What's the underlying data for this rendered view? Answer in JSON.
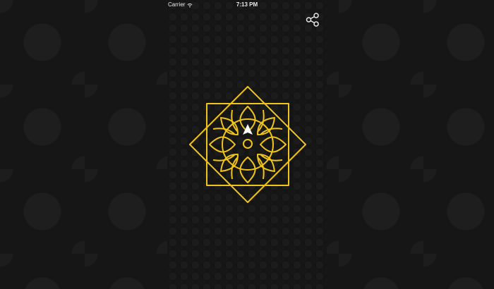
{
  "status_bar": {
    "carrier": "Carrier",
    "time": "7:13 PM"
  },
  "icons": {
    "wifi": "wifi-icon",
    "share": "share-icon",
    "compass_arrow": "navigation-arrow-icon"
  },
  "colors": {
    "background": "#151515",
    "screen_background": "#111111",
    "accent": "#f0c419",
    "status_text": "#e9e9e9"
  }
}
